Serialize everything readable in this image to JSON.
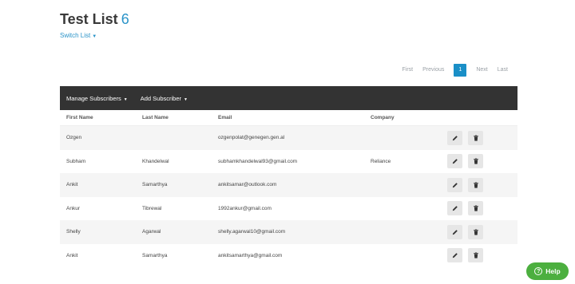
{
  "header": {
    "title": "Test List",
    "count": "6",
    "switch_label": "Switch List"
  },
  "pagination": {
    "first": "First",
    "previous": "Previous",
    "current": "1",
    "next": "Next",
    "last": "Last"
  },
  "toolbar": {
    "manage_label": "Manage Subscribers",
    "add_label": "Add Subscriber"
  },
  "table": {
    "columns": [
      "First Name",
      "Last Name",
      "Email",
      "Company"
    ],
    "rows": [
      {
        "first": "Ozgen",
        "last": "",
        "email": "ozgenpolat@genegen.gen.al",
        "company": ""
      },
      {
        "first": "Subham",
        "last": "Khandelwal",
        "email": "subhamkhandelwal93@gmail.com",
        "company": "Reliance"
      },
      {
        "first": "Ankit",
        "last": "Samarthya",
        "email": "ankitsamar@outlook.com",
        "company": ""
      },
      {
        "first": "Ankur",
        "last": "Tibrewal",
        "email": "1992ankur@gmail.com",
        "company": ""
      },
      {
        "first": "Shelly",
        "last": "Agarwal",
        "email": "shelly.agarwal10@gmail.com",
        "company": ""
      },
      {
        "first": "Ankit",
        "last": "Samarthya",
        "email": "ankitsamarthya@gmail.com",
        "company": ""
      }
    ]
  },
  "help": {
    "label": "Help"
  },
  "colors": {
    "accent": "#2a93c8",
    "toolbar_bg": "#333333",
    "help_bg": "#4caf3f"
  },
  "icons": {
    "edit": "pencil-icon",
    "delete": "trash-icon",
    "help": "question-circle-icon"
  }
}
